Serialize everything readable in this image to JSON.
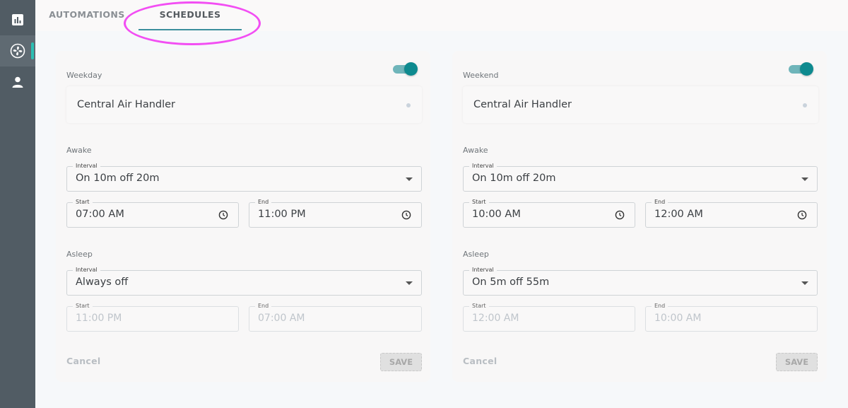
{
  "tabs": {
    "automations": "AUTOMATIONS",
    "schedules": "SCHEDULES"
  },
  "colors": {
    "sidebar": "#515c64",
    "accent": "#0e8a8f",
    "highlight": "#f24ef3"
  },
  "sidebar": {
    "items": [
      {
        "icon": "bar-chart-icon"
      },
      {
        "icon": "fan-icon",
        "active": true
      },
      {
        "icon": "person-icon"
      }
    ]
  },
  "schedules": [
    {
      "label": "Weekday",
      "enabled": true,
      "device": "Central Air Handler",
      "awake": {
        "section_label": "Awake",
        "interval_label": "Interval",
        "interval": "On 10m off 20m",
        "start_label": "Start",
        "start": "07:00 AM",
        "end_label": "End",
        "end": "11:00 PM"
      },
      "asleep": {
        "section_label": "Asleep",
        "interval_label": "Interval",
        "interval": "Always off",
        "start_label": "Start",
        "start": "11:00 PM",
        "end_label": "End",
        "end": "07:00 AM"
      },
      "cancel": "Cancel",
      "save": "SAVE"
    },
    {
      "label": "Weekend",
      "enabled": true,
      "device": "Central Air Handler",
      "awake": {
        "section_label": "Awake",
        "interval_label": "Interval",
        "interval": "On 10m off 20m",
        "start_label": "Start",
        "start": "10:00 AM",
        "end_label": "End",
        "end": "12:00 AM"
      },
      "asleep": {
        "section_label": "Asleep",
        "interval_label": "Interval",
        "interval": "On 5m off 55m",
        "start_label": "Start",
        "start": "12:00 AM",
        "end_label": "End",
        "end": "10:00 AM"
      },
      "cancel": "Cancel",
      "save": "SAVE"
    }
  ]
}
